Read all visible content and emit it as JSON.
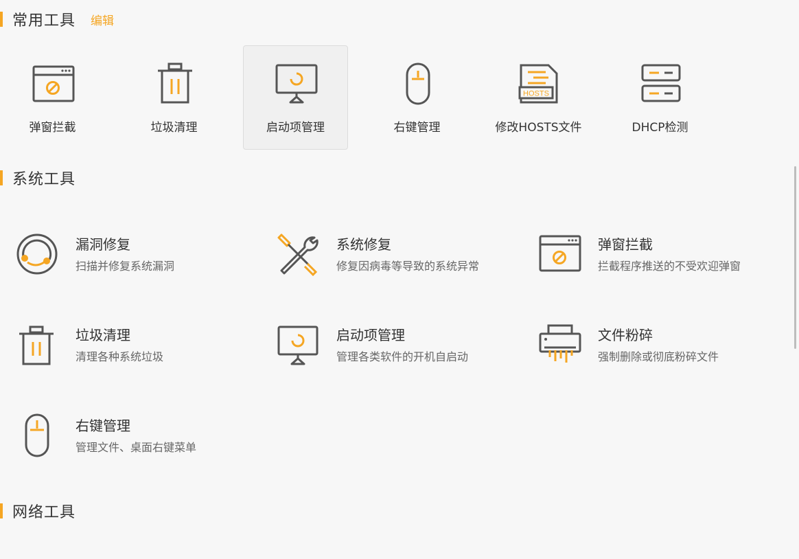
{
  "colors": {
    "accent": "#f5a623",
    "icon_stroke": "#555555",
    "selected_bg": "#f0f0f0"
  },
  "common": {
    "title": "常用工具",
    "edit_label": "编辑",
    "items": [
      {
        "label": "弹窗拦截",
        "icon": "popup-block-icon"
      },
      {
        "label": "垃圾清理",
        "icon": "trash-icon"
      },
      {
        "label": "启动项管理",
        "icon": "monitor-startup-icon",
        "selected": true
      },
      {
        "label": "右键管理",
        "icon": "mouse-icon"
      },
      {
        "label": "修改HOSTS文件",
        "icon": "hosts-file-icon"
      },
      {
        "label": "DHCP检测",
        "icon": "server-icon"
      }
    ]
  },
  "system": {
    "title": "系统工具",
    "items": [
      {
        "title": "漏洞修复",
        "desc": "扫描并修复系统漏洞",
        "icon": "vulnerability-repair-icon"
      },
      {
        "title": "系统修复",
        "desc": "修复因病毒等导致的系统异常",
        "icon": "tools-icon"
      },
      {
        "title": "弹窗拦截",
        "desc": "拦截程序推送的不受欢迎弹窗",
        "icon": "popup-block-icon"
      },
      {
        "title": "垃圾清理",
        "desc": "清理各种系统垃圾",
        "icon": "trash-icon"
      },
      {
        "title": "启动项管理",
        "desc": "管理各类软件的开机自启动",
        "icon": "monitor-startup-icon"
      },
      {
        "title": "文件粉碎",
        "desc": "强制删除或彻底粉碎文件",
        "icon": "shredder-icon"
      },
      {
        "title": "右键管理",
        "desc": "管理文件、桌面右键菜单",
        "icon": "mouse-icon"
      }
    ]
  },
  "network": {
    "title": "网络工具"
  }
}
